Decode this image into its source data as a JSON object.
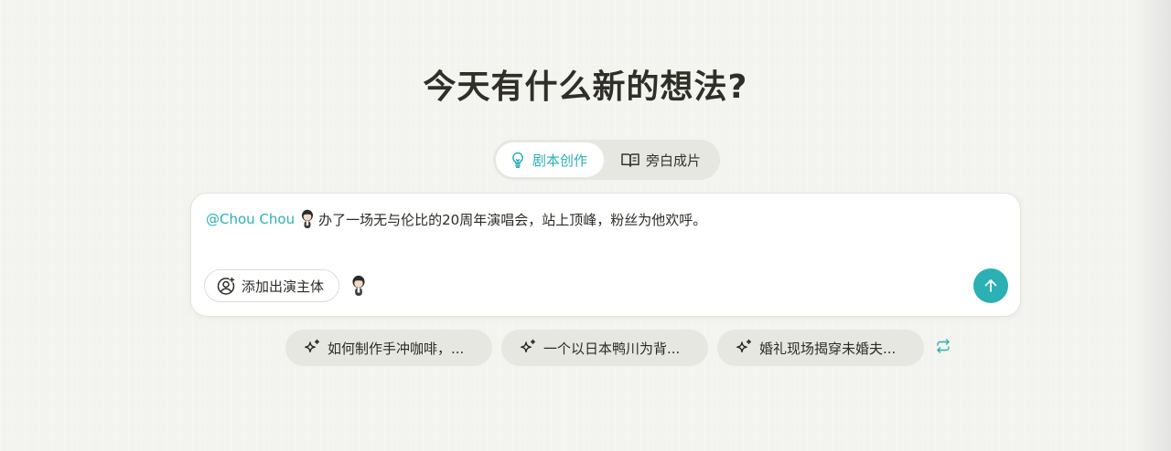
{
  "heading": "今天有什么新的想法?",
  "modes": [
    {
      "label": "剧本创作",
      "icon": "lightbulb-icon",
      "active": true
    },
    {
      "label": "旁白成片",
      "icon": "open-book-icon",
      "active": false
    }
  ],
  "prompt": {
    "mention": "@Chou Chou",
    "text": "办了一场无与伦比的20周年演唱会，站上顶峰，粉丝为他欢呼。"
  },
  "add_actor_label": "添加出演主体",
  "suggestions": [
    "如何制作手冲咖啡，...",
    "一个以日本鸭川为背...",
    "婚礼现场揭穿未婚夫..."
  ],
  "colors": {
    "accent": "#2bb0b4",
    "background": "#f3f3ef",
    "chip": "#e7e7e1"
  }
}
